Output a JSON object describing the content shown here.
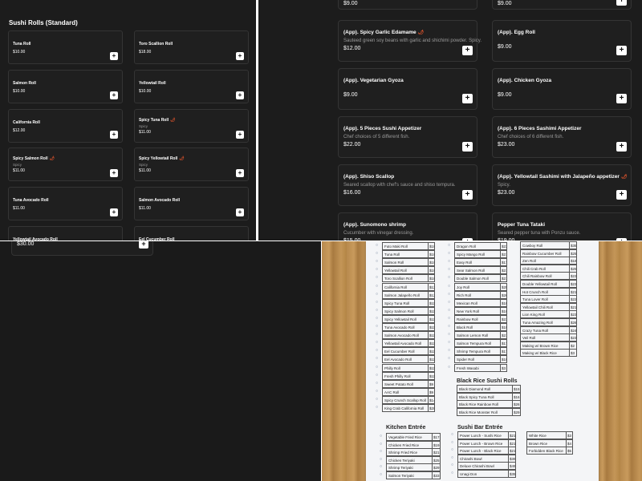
{
  "sushi_panel": {
    "title": "Sushi Rolls (Standard)",
    "items": [
      {
        "name": "Tuna Roll",
        "price": "$10.00",
        "desc": "",
        "spicy": false
      },
      {
        "name": "Toro Scallion Roll",
        "price": "$18.00",
        "desc": "",
        "spicy": false
      },
      {
        "name": "Salmon Roll",
        "price": "$10.00",
        "desc": "",
        "spicy": false
      },
      {
        "name": "Yellowtail Roll",
        "price": "$10.00",
        "desc": "",
        "spicy": false
      },
      {
        "name": "California Roll",
        "price": "$12.00",
        "desc": "",
        "spicy": false
      },
      {
        "name": "Spicy Tuna Roll",
        "price": "$11.00",
        "desc": "Spicy",
        "spicy": true
      },
      {
        "name": "Spicy Salmon Roll",
        "price": "$11.00",
        "desc": "Spicy",
        "spicy": true
      },
      {
        "name": "Spicy Yellowtail Roll",
        "price": "$11.00",
        "desc": "Spicy",
        "spicy": true
      },
      {
        "name": "Tuna Avocado Roll",
        "price": "$11.00",
        "desc": "",
        "spicy": false
      },
      {
        "name": "Salmon Avocado Roll",
        "price": "$11.00",
        "desc": "",
        "spicy": false
      },
      {
        "name": "Yellowtail Avocado Roll",
        "price": "",
        "desc": "",
        "spicy": false
      },
      {
        "name": "Eel Cucumber Roll",
        "price": "",
        "desc": "",
        "spicy": false
      }
    ],
    "add_label": "+"
  },
  "appetizer_panel": {
    "top_prices": [
      "$9.00",
      "$9.00"
    ],
    "items": [
      {
        "name": "(App). Spicy Garlic Edamame",
        "desc": "Sauteed green soy beans with garlic and shichimi powder. Spicy.",
        "price": "$12.00",
        "spicy": true
      },
      {
        "name": "(App). Egg Roll",
        "desc": "",
        "price": "$9.00",
        "spicy": false
      },
      {
        "name": "(App). Vegetarian Gyoza",
        "desc": "",
        "price": "$9.00",
        "spicy": false
      },
      {
        "name": "(App). Chicken Gyoza",
        "desc": "",
        "price": "$9.00",
        "spicy": false
      },
      {
        "name": "(App). 5 Pieces Sushi Appetizer",
        "desc": "Chef choices of 5 different fish.",
        "price": "$22.00",
        "spicy": false
      },
      {
        "name": "(App). 6 Pieces Sashimi Appetizer",
        "desc": "Chef choices of 6 different fish.",
        "price": "$23.00",
        "spicy": false
      },
      {
        "name": "(App). Shiso Scallop",
        "desc": "Seared scallop with chef's sauce and shiso tempura.",
        "price": "$16.00",
        "spicy": false
      },
      {
        "name": "(App). Yellowtail Sashimi with Jalapeño appetizer",
        "desc": "Spicy.",
        "price": "$23.00",
        "spicy": true
      },
      {
        "name": "(App). Sunomono shrimp",
        "desc": "Cucumber with vinegar dressing.",
        "price": "$15.00",
        "spicy": false
      },
      {
        "name": "Pepper Tuna Tataki",
        "desc": "Seared pepper tuna with Ponzu sauce.",
        "price": "$19.00",
        "spicy": false
      }
    ],
    "add_label": "+"
  },
  "partial_panel": {
    "price": "$30.00",
    "add_label": "+"
  },
  "paper_menu": {
    "col1": [
      {
        "name": "Futo Maki Roll",
        "price": "$10"
      },
      {
        "name": "Tuna Roll",
        "price": "$10"
      },
      {
        "name": "Salmon Roll",
        "price": "$10"
      },
      {
        "name": "Yellowtail Roll",
        "price": "$10"
      },
      {
        "name": "Toro Scallion Roll",
        "price": "$18"
      },
      {
        "name": "California Roll",
        "price": "$12"
      },
      {
        "name": "Salmon Jalapeño Roll",
        "price": "$12"
      },
      {
        "name": "Spicy Tuna Roll",
        "price": "$11"
      },
      {
        "name": "Spicy Salmon Roll",
        "price": "$11"
      },
      {
        "name": "Spicy Yellowtail Roll",
        "price": "$11"
      },
      {
        "name": "Tuna Avocado Roll",
        "price": "$11"
      },
      {
        "name": "Salmon Avocado Roll",
        "price": "$11"
      },
      {
        "name": "Yellowtail Avocado Roll",
        "price": "$11"
      },
      {
        "name": "Eel Cucumber Roll",
        "price": "$11"
      },
      {
        "name": "Eel Avocado Roll",
        "price": "$11"
      },
      {
        "name": "Philly Roll",
        "price": "$11"
      },
      {
        "name": "Fresh Philly Roll",
        "price": "$11"
      },
      {
        "name": "Sweet Potato Roll",
        "price": "$9"
      },
      {
        "name": "AAC Roll",
        "price": "$9"
      },
      {
        "name": "Spicy Crunch Scallop Roll",
        "price": "$14"
      },
      {
        "name": "King Crab California Roll",
        "price": "$20"
      }
    ],
    "col2": [
      {
        "name": "Dragon Roll",
        "price": "$23"
      },
      {
        "name": "Spicy Mango Roll",
        "price": "$21"
      },
      {
        "name": "Easy Roll",
        "price": "$17"
      },
      {
        "name": "Sear Salmon Roll",
        "price": "$21"
      },
      {
        "name": "Double Salmon Roll",
        "price": "$21"
      },
      {
        "name": "Joy Roll",
        "price": "$25"
      },
      {
        "name": "Rich Roll",
        "price": "$26"
      },
      {
        "name": "Mexican Roll",
        "price": "$19"
      },
      {
        "name": "New York Roll",
        "price": "$19"
      },
      {
        "name": "Rainbow Roll",
        "price": "$23"
      },
      {
        "name": "Black Roll",
        "price": "$19"
      },
      {
        "name": "Salmon Lemon Roll",
        "price": "$21"
      },
      {
        "name": "Salmon Tempura Roll",
        "price": "$17"
      },
      {
        "name": "Shrimp Tempura Roll",
        "price": "$17"
      },
      {
        "name": "Spider Roll",
        "price": "$19"
      },
      {
        "name": "Fresh Wasabi",
        "price": "$3"
      }
    ],
    "col3": [
      {
        "name": "Cowboy Roll",
        "price": "$35"
      },
      {
        "name": "Rainbow Cucumber Roll",
        "price": "$25"
      },
      {
        "name": "Zen Roll",
        "price": "$18"
      },
      {
        "name": "Chili Crab Roll",
        "price": "$25"
      },
      {
        "name": "Chili Rainbow Roll",
        "price": "$23"
      },
      {
        "name": "Double Yellowtail Roll",
        "price": "$23"
      },
      {
        "name": "Hot Crunch Roll",
        "price": "$21"
      },
      {
        "name": "Tuna Lover Roll",
        "price": "$22"
      },
      {
        "name": "Yellowtail Chili Roll",
        "price": "$21"
      },
      {
        "name": "Lion King Roll",
        "price": "$23"
      },
      {
        "name": "Tuna Amazing Roll",
        "price": "$26"
      },
      {
        "name": "Crazy Tuna Roll",
        "price": "$24"
      },
      {
        "name": "Veil Roll",
        "price": "$23"
      },
      {
        "name": "Making w/ Brown Rice",
        "price": "$2"
      },
      {
        "name": "Making w/ Black Rice",
        "price": "$3"
      }
    ],
    "black_rice_title": "Black Rice Sushi Rolls",
    "black_rice": [
      {
        "name": "Black Diamond Roll",
        "price": "$15"
      },
      {
        "name": "Black Spicy Tuna Roll",
        "price": "$16"
      },
      {
        "name": "Black Rice Rainbow Roll",
        "price": "$26"
      },
      {
        "name": "Black Rice Monster Roll",
        "price": "$29"
      }
    ],
    "kitchen_title": "Kitchen Entrée",
    "kitchen": [
      {
        "name": "Vegetable Fried Rice",
        "price": "$17"
      },
      {
        "name": "Chicken Fried Rice",
        "price": "$19"
      },
      {
        "name": "Shrimp Fried Rice",
        "price": "$21"
      },
      {
        "name": "Chicken Teriyaki",
        "price": "$25"
      },
      {
        "name": "Shrimp Teriyaki",
        "price": "$29"
      },
      {
        "name": "Salmon Teriyaki",
        "price": "$33"
      }
    ],
    "sushi_bar_title": "Sushi Bar Entrée",
    "sushi_bar": [
      {
        "name": "Power Lunch - Sushi Rice",
        "price": "$21"
      },
      {
        "name": "Power Lunch - Brown Rice",
        "price": "$21"
      },
      {
        "name": "Power Lunch - Black Rice",
        "price": "$21"
      },
      {
        "name": "Chirashi Bowl",
        "price": "$39"
      },
      {
        "name": "Deluxe Chirashi Bowl",
        "price": "$49"
      },
      {
        "name": "Unagi Don",
        "price": "$35"
      }
    ],
    "rice": [
      {
        "name": "White Rice",
        "price": "$3"
      },
      {
        "name": "Brown Rice",
        "price": "$4"
      },
      {
        "name": "Forbidden Black Rice",
        "price": "$5"
      }
    ]
  }
}
